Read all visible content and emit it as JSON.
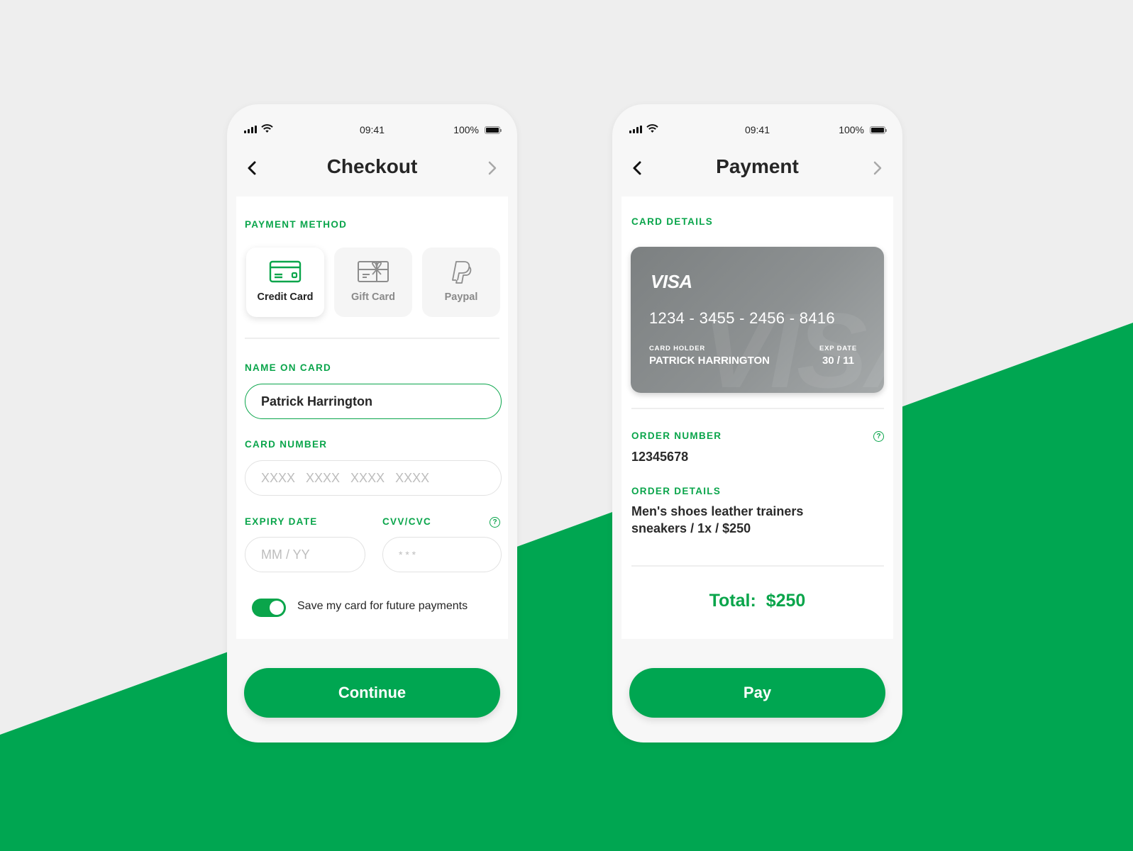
{
  "theme": {
    "accent": "#00a651",
    "background": "#eeeeee"
  },
  "status_bar": {
    "time": "09:41",
    "battery": "100%"
  },
  "checkout": {
    "title": "Checkout",
    "payment_method_label": "PAYMENT METHOD",
    "methods": [
      {
        "label": "Credit Card",
        "icon": "credit-card-icon",
        "selected": true
      },
      {
        "label": "Gift Card",
        "icon": "gift-card-icon",
        "selected": false
      },
      {
        "label": "Paypal",
        "icon": "paypal-icon",
        "selected": false
      }
    ],
    "name_label": "NAME ON CARD",
    "name_value": "Patrick Harrington",
    "card_number_label": "CARD NUMBER",
    "card_number_placeholder": "XXXX   XXXX   XXXX   XXXX",
    "expiry_label": "EXPIRY DATE",
    "expiry_placeholder": "MM / YY",
    "cvv_label": "CVV/CVC",
    "cvv_placeholder": "* * *",
    "save_card_label": "Save my card for future payments",
    "save_card_enabled": true,
    "continue_label": "Continue"
  },
  "payment": {
    "title": "Payment",
    "card_details_label": "CARD DETAILS",
    "card": {
      "brand": "VISA",
      "number": "1234 - 3455 - 2456 - 8416",
      "holder_label": "CARD HOLDER",
      "holder": "PATRICK HARRINGTON",
      "exp_label": "EXP DATE",
      "exp": "30 / 11"
    },
    "order_number_label": "ORDER NUMBER",
    "order_number": "12345678",
    "order_details_label": "ORDER DETAILS",
    "order_details_line1": "Men's shoes leather trainers",
    "order_details_line2": "sneakers / 1x / $250",
    "total": "Total:  $250",
    "pay_label": "Pay"
  }
}
